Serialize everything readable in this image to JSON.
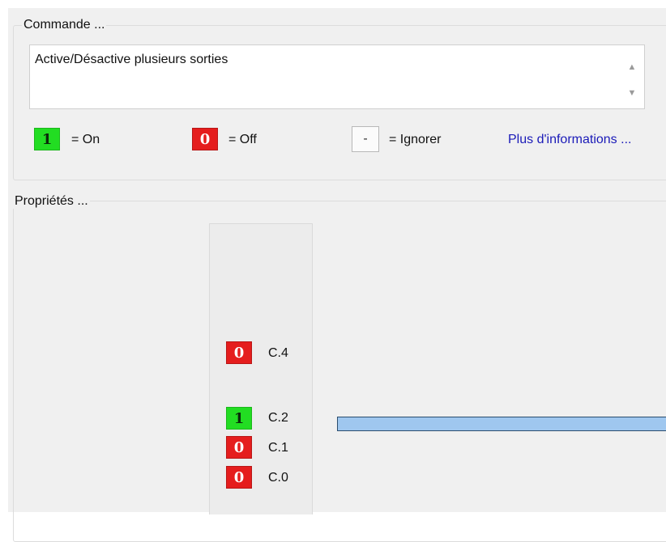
{
  "command_group": {
    "title": "Commande ...",
    "description": "Active/Désactive plusieurs sorties",
    "scroll_up": "▲",
    "scroll_down": "▼"
  },
  "legend": {
    "on": {
      "chip": "1",
      "label": "= On",
      "color": "#22dd22"
    },
    "off": {
      "chip": "0",
      "label": "= Off",
      "color": "#e51d1d"
    },
    "ignore": {
      "chip": "-",
      "label": "= Ignorer"
    },
    "more_info": "Plus d'informations ..."
  },
  "properties_group": {
    "title": "Propriétés ...",
    "outputs": [
      {
        "chip": "0",
        "state": "off",
        "label": "C.4"
      },
      {
        "chip": "1",
        "state": "on",
        "label": "C.2"
      },
      {
        "chip": "0",
        "state": "off",
        "label": "C.1"
      },
      {
        "chip": "0",
        "state": "off",
        "label": "C.0"
      }
    ],
    "bar_color": "#9fc7ef"
  }
}
